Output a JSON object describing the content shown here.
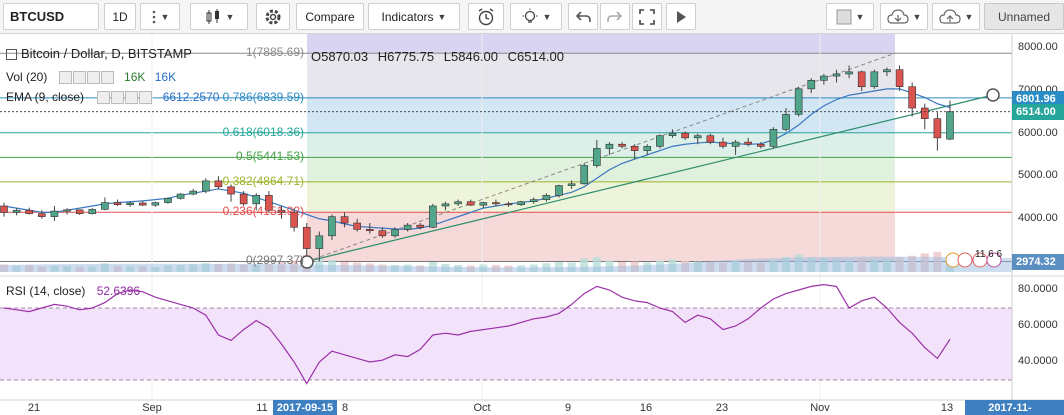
{
  "toolbar": {
    "symbol": "BTCUSD",
    "interval": "1D",
    "compare_label": "Compare",
    "indicators_label": "Indicators",
    "layout_name": "Unnamed",
    "icons": [
      "menu-dots-icon",
      "bar-style-icon",
      "settings-gear-icon",
      "alert-clock-icon",
      "lightbulb-icon",
      "undo-icon",
      "redo-icon",
      "fullscreen-icon",
      "play-icon",
      "snapshot-icon",
      "cloud-download-icon",
      "cloud-upload-icon"
    ]
  },
  "legend": {
    "title": "Bitcoin / Dollar, D, BITSTAMP",
    "ohlc": {
      "O": "5870.03",
      "H": "6775.75",
      "L": "5846.00",
      "C": "6514.00"
    },
    "vol_label": "Vol (20)",
    "vol_a": "16K",
    "vol_b": "16K",
    "ema_label": "EMA (9, close)",
    "ema_value": "6612.2570",
    "rsi_label": "RSI (14, close)",
    "rsi_value": "52.6396"
  },
  "fib_levels": [
    {
      "label": "1(7885.69)",
      "value": 7885.69,
      "color": "#8a8a8a"
    },
    {
      "label": "0.786(6839.59)",
      "value": 6839.59,
      "color": "#2a8cc4"
    },
    {
      "label": "0.618(6018.36)",
      "value": 6018.36,
      "color": "#26a69a"
    },
    {
      "label": "0.5(5441.53)",
      "value": 5441.53,
      "color": "#43a047"
    },
    {
      "label": "0.382(4864.71)",
      "value": 4864.71,
      "color": "#9cb52f"
    },
    {
      "label": "0.236(4151.92)",
      "value": 4151.92,
      "color": "#e05050"
    },
    {
      "label": "0(2997.37)",
      "value": 2997.37,
      "color": "#777777"
    }
  ],
  "price_axis": {
    "ticks": [
      "8000.00",
      "7000.00",
      "6000.00",
      "5000.00",
      "4000.00",
      "3000.00"
    ],
    "tags": [
      {
        "label": "6801.96",
        "value": 6801.96,
        "color": "#2a8cc4"
      },
      {
        "label": "6514.00",
        "value": 6514.0,
        "color": "#26a69a"
      },
      {
        "label": "2974.32",
        "value": 2974.32,
        "color": "#5b8fc2"
      }
    ]
  },
  "rsi_axis": {
    "ticks": [
      "80.0000",
      "60.0000",
      "40.0000"
    ]
  },
  "time_axis": {
    "labels": [
      "21",
      "Sep",
      "11",
      "2017-09-15",
      "8",
      "Oct",
      "9",
      "16",
      "23",
      "Nov",
      "13",
      "2017-11-"
    ],
    "highlight": [
      "2017-09-15",
      "2017-11-"
    ]
  },
  "events_badge": "11 6 6",
  "chart_data": {
    "type": "candlestick",
    "candles": [
      [
        4300,
        4380,
        4050,
        4150
      ],
      [
        4150,
        4250,
        4080,
        4200
      ],
      [
        4200,
        4260,
        4100,
        4120
      ],
      [
        4120,
        4200,
        4000,
        4050
      ],
      [
        4050,
        4300,
        3950,
        4180
      ],
      [
        4180,
        4250,
        4100,
        4210
      ],
      [
        4210,
        4220,
        4090,
        4120
      ],
      [
        4120,
        4250,
        4100,
        4220
      ],
      [
        4220,
        4500,
        4200,
        4380
      ],
      [
        4380,
        4450,
        4300,
        4330
      ],
      [
        4330,
        4400,
        4280,
        4370
      ],
      [
        4370,
        4420,
        4300,
        4320
      ],
      [
        4320,
        4400,
        4280,
        4380
      ],
      [
        4380,
        4500,
        4350,
        4480
      ],
      [
        4480,
        4600,
        4450,
        4580
      ],
      [
        4580,
        4700,
        4550,
        4650
      ],
      [
        4650,
        4950,
        4600,
        4890
      ],
      [
        4890,
        5000,
        4700,
        4750
      ],
      [
        4750,
        4800,
        4400,
        4580
      ],
      [
        4580,
        4650,
        4300,
        4350
      ],
      [
        4350,
        4600,
        4200,
        4550
      ],
      [
        4550,
        4650,
        4150,
        4200
      ],
      [
        4200,
        4300,
        4000,
        4150
      ],
      [
        4150,
        4250,
        3700,
        3800
      ],
      [
        3800,
        3900,
        3100,
        3300
      ],
      [
        3300,
        3700,
        3000,
        3600
      ],
      [
        3600,
        4100,
        3500,
        4050
      ],
      [
        4050,
        4150,
        3800,
        3900
      ],
      [
        3900,
        4000,
        3700,
        3750
      ],
      [
        3750,
        3900,
        3650,
        3720
      ],
      [
        3720,
        3800,
        3550,
        3600
      ],
      [
        3600,
        3800,
        3550,
        3750
      ],
      [
        3750,
        3900,
        3700,
        3850
      ],
      [
        3850,
        3900,
        3750,
        3800
      ],
      [
        3800,
        4350,
        3780,
        4300
      ],
      [
        4300,
        4400,
        4200,
        4350
      ],
      [
        4350,
        4450,
        4300,
        4400
      ],
      [
        4400,
        4450,
        4300,
        4320
      ],
      [
        4320,
        4400,
        4250,
        4380
      ],
      [
        4380,
        4450,
        4300,
        4350
      ],
      [
        4350,
        4400,
        4280,
        4330
      ],
      [
        4330,
        4420,
        4300,
        4400
      ],
      [
        4400,
        4500,
        4350,
        4450
      ],
      [
        4450,
        4600,
        4400,
        4550
      ],
      [
        4550,
        4800,
        4500,
        4780
      ],
      [
        4780,
        4900,
        4700,
        4820
      ],
      [
        4820,
        5300,
        4800,
        5250
      ],
      [
        5250,
        5850,
        5200,
        5650
      ],
      [
        5650,
        5800,
        5500,
        5750
      ],
      [
        5750,
        5800,
        5650,
        5700
      ],
      [
        5700,
        5750,
        5400,
        5600
      ],
      [
        5600,
        5750,
        5500,
        5700
      ],
      [
        5700,
        5980,
        5650,
        5950
      ],
      [
        5950,
        6100,
        5900,
        6010
      ],
      [
        6010,
        6050,
        5850,
        5900
      ],
      [
        5900,
        6000,
        5750,
        5950
      ],
      [
        5950,
        6000,
        5750,
        5800
      ],
      [
        5800,
        5900,
        5650,
        5700
      ],
      [
        5700,
        5850,
        5500,
        5800
      ],
      [
        5800,
        5900,
        5700,
        5750
      ],
      [
        5750,
        5800,
        5650,
        5700
      ],
      [
        5700,
        6150,
        5650,
        6100
      ],
      [
        6100,
        6600,
        6050,
        6450
      ],
      [
        6450,
        7100,
        6400,
        7050
      ],
      [
        7050,
        7300,
        6950,
        7250
      ],
      [
        7250,
        7400,
        7150,
        7350
      ],
      [
        7350,
        7500,
        7200,
        7400
      ],
      [
        7400,
        7600,
        7300,
        7450
      ],
      [
        7450,
        7480,
        7000,
        7100
      ],
      [
        7100,
        7500,
        7050,
        7450
      ],
      [
        7450,
        7550,
        7350,
        7500
      ],
      [
        7500,
        7600,
        7000,
        7100
      ],
      [
        7100,
        7200,
        6400,
        6600
      ],
      [
        6600,
        6700,
        6100,
        6350
      ],
      [
        6350,
        6500,
        5600,
        5900
      ],
      [
        5870.03,
        6775.75,
        5846.0,
        6514.0
      ]
    ],
    "ema": [
      4300,
      4250,
      4200,
      4150,
      4150,
      4200,
      4250,
      4300,
      4350,
      4380,
      4400,
      4420,
      4450,
      4480,
      4550,
      4600,
      4650,
      4700,
      4650,
      4600,
      4500,
      4400,
      4300,
      4200,
      4100,
      4000,
      3950,
      3880,
      3820,
      3800,
      3780,
      3760,
      3750,
      3780,
      3850,
      3950,
      4050,
      4150,
      4250,
      4300,
      4350,
      4380,
      4420,
      4480,
      4550,
      4620,
      4750,
      4950,
      5150,
      5300,
      5400,
      5500,
      5600,
      5700,
      5750,
      5780,
      5800,
      5780,
      5760,
      5750,
      5760,
      5850,
      6000,
      6200,
      6450,
      6650,
      6800,
      6900,
      6950,
      7000,
      7050,
      7050,
      6950,
      6850,
      6700,
      6612.257
    ],
    "rsi": [
      70,
      69,
      68,
      70,
      72,
      71,
      69,
      70,
      73,
      78,
      80,
      79,
      76,
      74,
      72,
      70,
      66,
      55,
      52,
      58,
      63,
      59,
      50,
      40,
      28,
      40,
      46,
      44,
      42,
      40,
      41,
      44,
      43,
      47,
      55,
      56,
      55,
      57,
      58,
      59,
      60,
      62,
      64,
      65,
      67,
      72,
      78,
      82,
      80,
      76,
      74,
      73,
      70,
      68,
      62,
      66,
      64,
      58,
      60,
      64,
      70,
      75,
      78,
      80,
      82,
      83,
      82,
      70,
      74,
      76,
      70,
      62,
      56,
      48,
      42,
      52.6396
    ],
    "volume": [
      30,
      25,
      28,
      22,
      26,
      24,
      20,
      22,
      35,
      25,
      22,
      24,
      20,
      26,
      28,
      30,
      35,
      32,
      34,
      30,
      28,
      32,
      40,
      45,
      70,
      55,
      48,
      40,
      38,
      34,
      30,
      28,
      30,
      26,
      40,
      32,
      28,
      26,
      30,
      28,
      26,
      27,
      30,
      35,
      40,
      38,
      55,
      60,
      45,
      40,
      42,
      38,
      45,
      50,
      45,
      42,
      40,
      38,
      44,
      40,
      38,
      46,
      60,
      70,
      58,
      55,
      52,
      48,
      55,
      50,
      52,
      60,
      65,
      75,
      80,
      62
    ],
    "trendline": {
      "from": [
        24,
        2997.37
      ],
      "to": [
        76,
        6801.96
      ]
    },
    "price_ylim": [
      2750,
      8150
    ],
    "rsi_ylim": [
      20,
      85
    ]
  }
}
